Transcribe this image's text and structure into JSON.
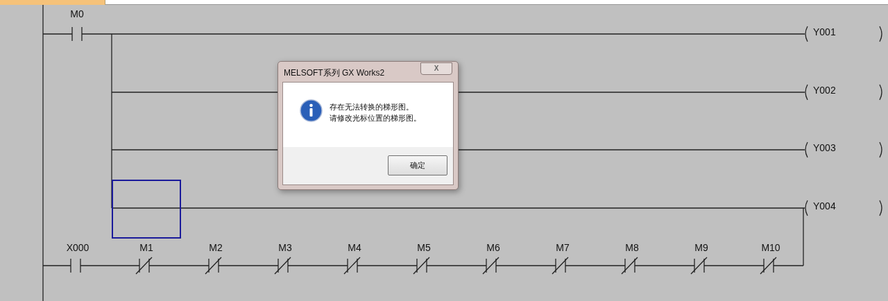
{
  "ladder": {
    "rung_1": {
      "contacts": [
        {
          "label": "M0",
          "kind": "no"
        }
      ],
      "coils": [
        "Y001",
        "Y002",
        "Y003"
      ]
    },
    "rung_2": {
      "contacts": [
        {
          "label": "X000",
          "kind": "no"
        },
        {
          "label": "M1",
          "kind": "nc"
        },
        {
          "label": "M2",
          "kind": "nc"
        },
        {
          "label": "M3",
          "kind": "nc"
        },
        {
          "label": "M4",
          "kind": "nc"
        },
        {
          "label": "M5",
          "kind": "nc"
        },
        {
          "label": "M6",
          "kind": "nc"
        },
        {
          "label": "M7",
          "kind": "nc"
        },
        {
          "label": "M8",
          "kind": "nc"
        },
        {
          "label": "M9",
          "kind": "nc"
        },
        {
          "label": "M10",
          "kind": "nc"
        }
      ],
      "coils": [
        "Y004"
      ]
    }
  },
  "dialog": {
    "title": "MELSOFT系列 GX Works2",
    "close": "X",
    "message": [
      "存在无法转换的梯形图。",
      "请修改光标位置的梯形图。"
    ],
    "button": "确定"
  }
}
